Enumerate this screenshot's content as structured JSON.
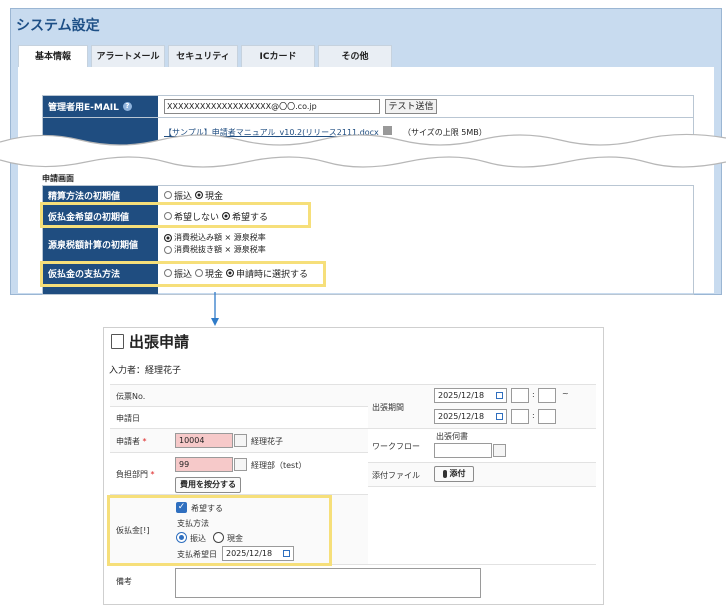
{
  "system": {
    "title": "システム設定",
    "tabs": [
      {
        "label": "基本情報",
        "active": true
      },
      {
        "label": "アラートメール"
      },
      {
        "label": "セキュリティ"
      },
      {
        "label": "ICカード"
      },
      {
        "label": "その他"
      }
    ],
    "admin_email": {
      "label": "管理者用E-MAIL",
      "value": "XXXXXXXXXXXXXXXXXXX@〇〇.co.jp",
      "button": "テスト送信"
    },
    "manual_row": {
      "file": "【サンプル】申請者マニュアル_v10.2(リリース2111.docx",
      "note": "（サイズの上限 5MB）"
    },
    "section_title": "申請画面",
    "rows": [
      {
        "label": "精算方法の初期値",
        "options": [
          "振込",
          "現金"
        ],
        "selected": 1
      },
      {
        "label": "仮払金希望の初期値",
        "options": [
          "希望しない",
          "希望する"
        ],
        "selected": 1,
        "highlight": true
      },
      {
        "label": "源泉税額計算の初期値",
        "options": [
          "消費税込み額 × 源泉税率",
          "消費税抜き額 × 源泉税率"
        ],
        "selected": 0
      },
      {
        "label": "仮払金の支払方法",
        "options": [
          "振込",
          "現金",
          "申請時に選択する"
        ],
        "selected": 2,
        "highlight": true
      }
    ]
  },
  "form": {
    "title": "出張申請",
    "inputter": "入力者：経理花子",
    "slip_no_label": "伝票No.",
    "date_label": "申請日",
    "applicant": {
      "label": "申請者",
      "required": "*",
      "code": "10004",
      "name": "経理花子"
    },
    "department": {
      "label": "負担部門",
      "required": "*",
      "code": "99",
      "name": "経理部（test）",
      "button": "費用を按分する"
    },
    "advance": {
      "label": "仮払金[!]",
      "checkbox_label": "希望する",
      "method_label": "支払方法",
      "options": [
        "振込",
        "現金"
      ],
      "selected": 0,
      "date_label": "支払希望日",
      "date": "2025/12/18"
    },
    "remarks_label": "備考",
    "period": {
      "label": "出張期間",
      "start": "2025/12/18",
      "end": "2025/12/18",
      "tilde": "~",
      "colon": ":"
    },
    "workflow": {
      "label": "ワークフロー",
      "caption": "出張伺書"
    },
    "attachment": {
      "label": "添付ファイル",
      "button": "添付"
    }
  },
  "colors": {
    "header_blue": "#1f4d80",
    "panel_blue": "#c8dbef",
    "highlight": "#f6df7a",
    "required_bg": "#f6c9c9",
    "arrow": "#2f7bc8"
  }
}
